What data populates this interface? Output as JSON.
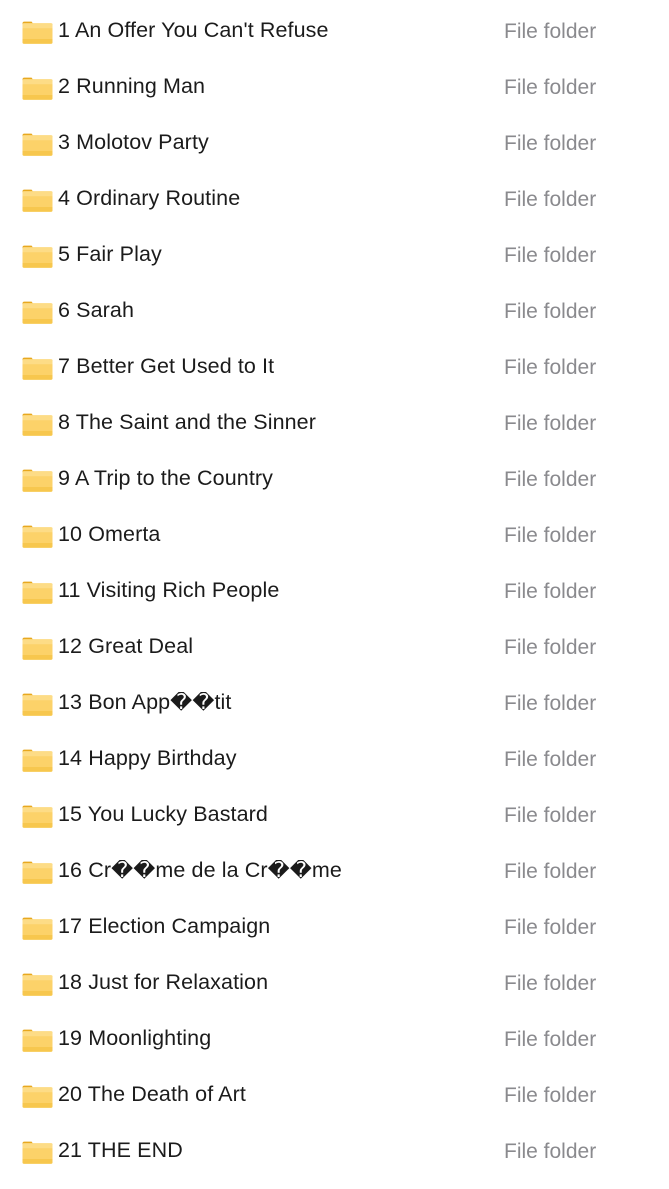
{
  "window": {
    "view_mode": "details-list",
    "background_color": "#ffffff",
    "name_text_color": "#1b1b1b",
    "type_text_color": "#8a8a8e",
    "folder_icon_color": "#fcd976",
    "folder_icon_tab_color": "#e9a825"
  },
  "columns": {
    "icon": "folder-icon",
    "name": "Name",
    "type": "Type"
  },
  "items": [
    {
      "name": "1 An Offer You Can't Refuse",
      "type": "File folder",
      "icon": "folder-icon"
    },
    {
      "name": "2 Running Man",
      "type": "File folder",
      "icon": "folder-icon"
    },
    {
      "name": "3 Molotov Party",
      "type": "File folder",
      "icon": "folder-icon"
    },
    {
      "name": "4 Ordinary Routine",
      "type": "File folder",
      "icon": "folder-icon"
    },
    {
      "name": "5 Fair Play",
      "type": "File folder",
      "icon": "folder-icon"
    },
    {
      "name": "6 Sarah",
      "type": "File folder",
      "icon": "folder-icon"
    },
    {
      "name": "7 Better Get Used to It",
      "type": "File folder",
      "icon": "folder-icon"
    },
    {
      "name": "8 The Saint and the Sinner",
      "type": "File folder",
      "icon": "folder-icon"
    },
    {
      "name": "9 A Trip to the Country",
      "type": "File folder",
      "icon": "folder-icon"
    },
    {
      "name": "10 Omerta",
      "type": "File folder",
      "icon": "folder-icon"
    },
    {
      "name": "11 Visiting Rich People",
      "type": "File folder",
      "icon": "folder-icon"
    },
    {
      "name": "12 Great Deal",
      "type": "File folder",
      "icon": "folder-icon"
    },
    {
      "name": "13 Bon App��tit",
      "type": "File folder",
      "icon": "folder-icon"
    },
    {
      "name": "14 Happy Birthday",
      "type": "File folder",
      "icon": "folder-icon"
    },
    {
      "name": "15 You Lucky Bastard",
      "type": "File folder",
      "icon": "folder-icon"
    },
    {
      "name": "16 Cr��me de la Cr��me",
      "type": "File folder",
      "icon": "folder-icon"
    },
    {
      "name": "17 Election Campaign",
      "type": "File folder",
      "icon": "folder-icon"
    },
    {
      "name": "18 Just for Relaxation",
      "type": "File folder",
      "icon": "folder-icon"
    },
    {
      "name": "19 Moonlighting",
      "type": "File folder",
      "icon": "folder-icon"
    },
    {
      "name": "20 The Death of Art",
      "type": "File folder",
      "icon": "folder-icon"
    },
    {
      "name": "21 THE END",
      "type": "File folder",
      "icon": "folder-icon"
    }
  ]
}
